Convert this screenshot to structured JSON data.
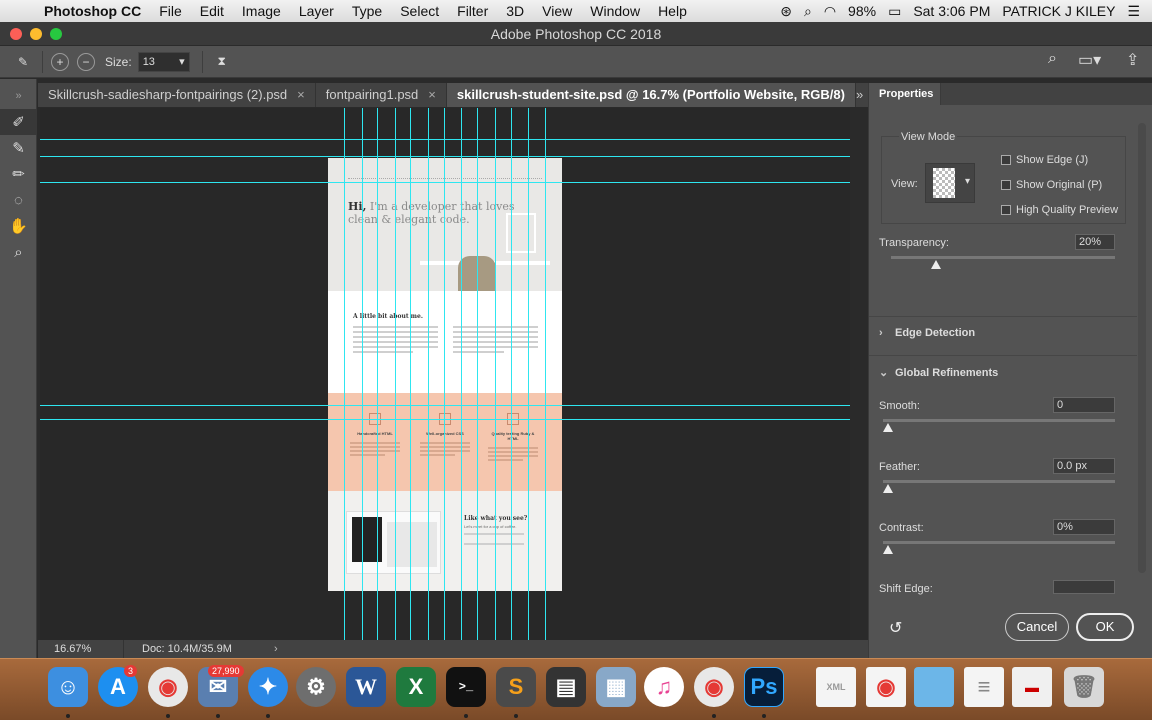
{
  "menubar": {
    "app_name": "Photoshop CC",
    "items": [
      "File",
      "Edit",
      "Image",
      "Layer",
      "Type",
      "Select",
      "Filter",
      "3D",
      "View",
      "Window",
      "Help"
    ],
    "battery": "98%",
    "clock": "Sat 3:06 PM",
    "user": "PATRICK J KILEY"
  },
  "window": {
    "title": "Adobe Photoshop CC 2018"
  },
  "options": {
    "size_label": "Size:",
    "size_value": "13"
  },
  "tabs": [
    {
      "label": "Skillcrush-sadiesharp-fontpairings (2).psd"
    },
    {
      "label": "fontpairing1.psd"
    },
    {
      "label": "skillcrush-student-site.psd @ 16.7% (Portfolio Website, RGB/8)"
    }
  ],
  "document": {
    "hero_hi": "Hi,",
    "hero_text": "I'm a developer that loves clean & elegant code.",
    "about_title": "A little bit about me.",
    "skills": [
      {
        "title": "Handcrafted HTML"
      },
      {
        "title": "Well-organized CSS"
      },
      {
        "title": "Quality testing Ruby & HTML"
      }
    ],
    "contact_title": "Like what you see?",
    "contact_sub": "Let's meet for a cup of coffee."
  },
  "status": {
    "zoom": "16.67%",
    "doc": "Doc: 10.4M/35.9M"
  },
  "properties": {
    "tab": "Properties",
    "view_mode": "View Mode",
    "view_label": "View:",
    "show_edge": "Show Edge (J)",
    "show_original": "Show Original (P)",
    "hq_preview": "High Quality Preview",
    "transparency_label": "Transparency:",
    "transparency_value": "20%",
    "transparency_level": 0.2,
    "edge_detection": "Edge Detection",
    "global_refinements": "Global Refinements",
    "smooth_label": "Smooth:",
    "smooth_value": "0",
    "feather_label": "Feather:",
    "feather_value": "0.0 px",
    "contrast_label": "Contrast:",
    "contrast_value": "0%",
    "shift_edge_label": "Shift Edge:",
    "cancel": "Cancel",
    "ok": "OK"
  },
  "dock": {
    "app_store_badge": "3",
    "mail_badge": "27,990",
    "apps": [
      "finder-icon",
      "app-store-icon",
      "chrome-icon",
      "mail-icon",
      "safari-icon",
      "system-preferences-icon",
      "word-icon",
      "excel-icon",
      "terminal-icon",
      "sublime-text-icon",
      "printer-icon",
      "preview-icon",
      "itunes-icon",
      "chrome-icon",
      "photoshop-icon",
      "xml-file-icon",
      "chrome-doc-icon",
      "folder-icon",
      "document-icon",
      "ribbon-icon",
      "trash-icon"
    ]
  }
}
